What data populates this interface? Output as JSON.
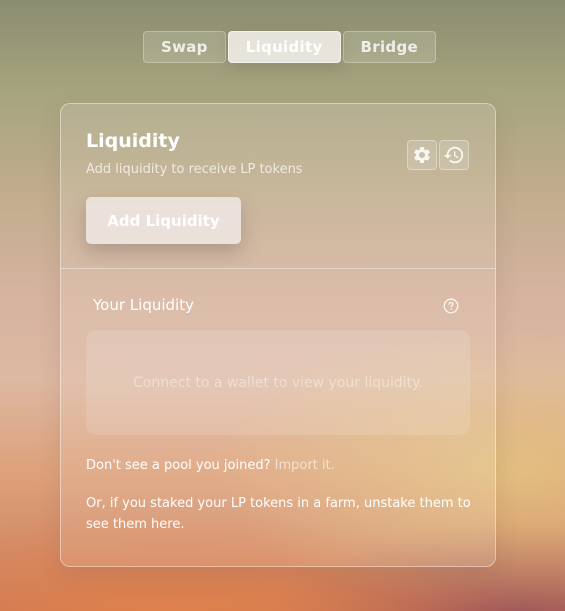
{
  "tabs": [
    {
      "label": "Swap",
      "active": false
    },
    {
      "label": "Liquidity",
      "active": true
    },
    {
      "label": "Bridge",
      "active": false
    }
  ],
  "card": {
    "title": "Liquidity",
    "subtitle": "Add liquidity to receive LP tokens",
    "settings_icon": "gear-icon",
    "history_icon": "history-icon",
    "add_button_label": "Add Liquidity"
  },
  "your_liquidity": {
    "label": "Your Liquidity",
    "help_icon": "question-circle-icon",
    "connect_message": "Connect to a wallet to view your liquidity."
  },
  "footer": {
    "missing_pool_text": "Don't see a pool you joined?",
    "import_link": "Import it.",
    "staked_text": "Or, if you staked your LP tokens in a farm, unstake them to see them here."
  }
}
